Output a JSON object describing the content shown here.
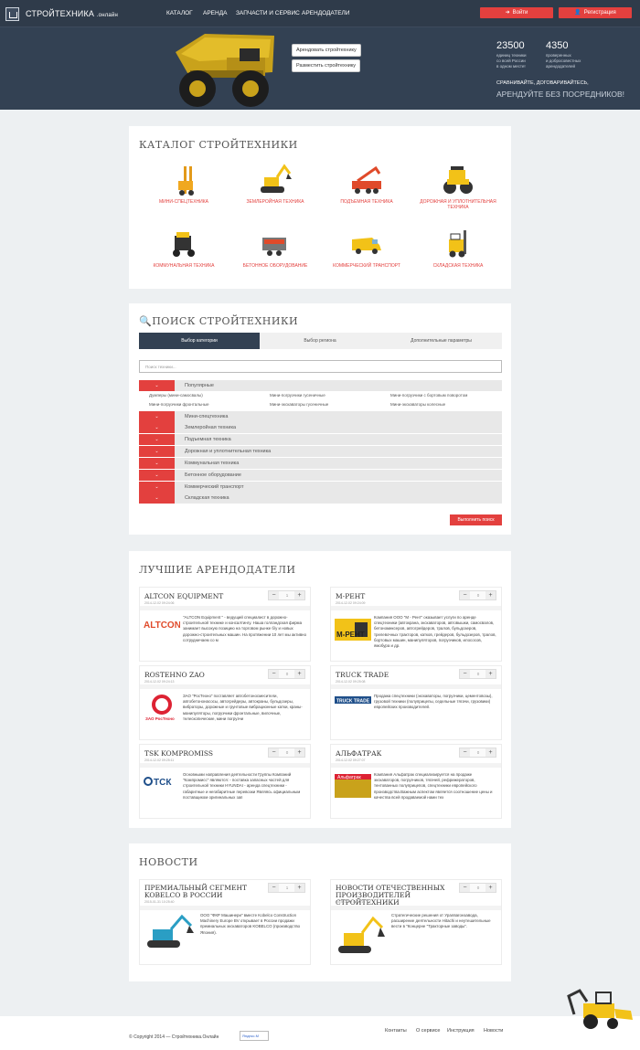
{
  "header": {
    "logo_main": "СТРОЙТЕХНИКА",
    "logo_suffix": ".онлайн",
    "nav": [
      "КАТАЛОГ",
      "АРЕНДА",
      "ЗАПЧАСТИ И СЕРВИС",
      "АРЕНДОДАТЕЛИ"
    ],
    "login_label": "Войти",
    "register_label": "Регистрация",
    "hero_buttons": [
      "Арендовать стройтехнику",
      "Разместить стройтехнику"
    ],
    "stats": [
      {
        "value": "23500",
        "text": [
          "единиц техники",
          "со всей России",
          "в одном месте!"
        ]
      },
      {
        "value": "4350",
        "text": [
          "проверенных",
          "и добросовестных",
          "арендодателей"
        ]
      }
    ],
    "tagline1": "СРАВНИВАЙТЕ, ДОГОВАРИВАЙТЕСЬ,",
    "tagline2": "АРЕНДУЙТЕ БЕЗ ПОСРЕДНИКОВ!"
  },
  "catalog": {
    "title": "КАТАЛОГ СТРОЙТЕХНИКИ",
    "items": [
      "МИНИ-СПЕЦТЕХНИКА",
      "ЗЕМЛЕРОЙНАЯ ТЕХНИКА",
      "ПОДЪЕМНАЯ ТЕХНИКА",
      "ДОРОЖНАЯ И УПЛОТНИТЕЛЬНАЯ ТЕХНИКА",
      "КОММУНАЛЬНАЯ ТЕХНИКА",
      "БЕТОННОЕ ОБОРУДОВАНИЕ",
      "КОММЕРЧЕСКИЙ ТРАНСПОРТ",
      "СКЛАДСКАЯ ТЕХНИКА"
    ]
  },
  "search": {
    "title": "ПОИСК СТРОЙТЕХНИКИ",
    "tabs": [
      "Выбор категории",
      "Выбор региона",
      "Дополнительные параметры"
    ],
    "placeholder": "Поиск техники...",
    "popular_label": "Популярные",
    "popular_items": [
      "Думперы (мини-самосвалы)",
      "Мини-погрузчики гусеничные",
      "Мини-погрузчики с бортовым поворотом",
      "Мини-погрузчики фронтальные",
      "Мини-экскаваторы гусеничные",
      "Мини-экскаваторы колесные"
    ],
    "categories": [
      "Мини-спецтехника",
      "Землеройная техника",
      "Подъемная техника",
      "Дорожная и уплотнительная техника",
      "Коммунальная техника",
      "Бетонное оборудование",
      "Коммерческий транспорт",
      "Складская техника"
    ],
    "submit_label": "Выполнить поиск"
  },
  "lessors": {
    "title": "ЛУЧШИЕ АРЕНДОДАТЕЛИ",
    "items": [
      {
        "name": "ALTCON EQUIPMENT",
        "date": "2014-12-02 09:24:06",
        "vote": "1",
        "logo_text": "ALTCON EQUIPMENT",
        "desc": "\"ALTCON Equipment \" - ведущий специалист в дорожно-строительной технике и консалтингу. Наша голландская фирма занимает высокую позицию на торговом рынке б/у и новых дорожно-строительных машин. На протяжении 10 лет мы активно сотрудничаем со м"
      },
      {
        "name": "М-РЕНТ",
        "date": "2014-12-02 09:24:09",
        "vote": "0",
        "logo_text": "М-РЕНТ",
        "desc": "Компания ООО \"М - Рент\" оказывает услуги по аренде спецтехники (автокрана, экскаваторов, автовышки, самосвалов, бетономиксеров, автогрейдеров, тралов, бульдозеров, трелевочных тракторов, катков, грейдеров, бульдозеров, тралов, бортовых машин, манипуляторов, погрузчиков, илососов, ямобура и др."
      },
      {
        "name": "ROSTEHNO ZAO",
        "date": "2014-12-02 09:24:13",
        "vote": "0",
        "logo_text": "ЗАО РосТехно",
        "desc": "ЗАО \"РосТехно\" поставляет автобетоносмесители, автобетононасосы, автогрейдеры, автокраны, бульдозеры, вибраторы, дорожные и грунтовые вибрационные катки, краны-манипуляторы, погрузчики фронтальные, вилочные, телескопические, мини погрузчи"
      },
      {
        "name": "TRUCK TRADE",
        "date": "2014-12-02 09:25:08",
        "vote": "0",
        "logo_text": "TRUCK TRADE",
        "desc": "Продажа спецтехники (экскаваторы, погрузчики, цементовозы), грузовой техники (полуприцепы, седельные тягачи, грузовики) европейских производителей."
      },
      {
        "name": "TSK KOMPROMISS",
        "date": "2014-12-02 09:25:11",
        "vote": "0",
        "logo_text": "ТСК",
        "desc": "Основными направления деятельности Группы Компаний \"Компромисс\" являются: - поставка запасных частей для строительной техники HYUNDAI - аренда спецтехники - габаритные и негабаритные перевозки Являясь официальным поставщиком оригинальных зап"
      },
      {
        "name": "АЛЬФАТРАК",
        "date": "2014-12-02 09:27:07",
        "vote": "0",
        "logo_text": "Альфатрак",
        "desc": "Компания Альфатрак специализируется на продаже экскаваторов, погрузчиков, тягачей, рефрижераторов, тентованных полуприцепов, спецтехники европейского производства.Важным аспектом является соотношение цены и качества всей продаваемой нами тех"
      }
    ]
  },
  "news": {
    "title": "НОВОСТИ",
    "items": [
      {
        "title": "ПРЕМИАЛЬНЫЙ СЕГМЕНТ KOBELCO В РОССИИ",
        "date": "2015-01-31 10:25:40",
        "vote": "1",
        "desc": "ООО \"ФКР Машинери\" вместе Kobelco Construction Machinery Europe BV открывает в России продажи премиальных экскаваторов KOBELCO (производство Япония)."
      },
      {
        "title": "НОВОСТИ ОТЕЧЕСТВЕННЫХ ПРОИЗВОДИТЕЛЕЙ СТРОЙТЕХНИКИ",
        "date": "2014-12-09 11:07:13",
        "vote": "0",
        "desc": "Стратегические решения от Уралвагонзавода, расширение деятельности Hitachi и неутешительные вести в \"Концерне \"Тракторные заводы\"."
      }
    ]
  },
  "footer": {
    "copyright": "© Copyright 2014 — Стройтехника.Онлайн",
    "counter_alt": "Яндекс.М",
    "links": [
      "Контакты",
      "О сервисе",
      "Инструкция",
      "Новости"
    ]
  },
  "colors": {
    "accent": "#e3403e",
    "header": "#334153",
    "bg": "#edf0f2"
  }
}
